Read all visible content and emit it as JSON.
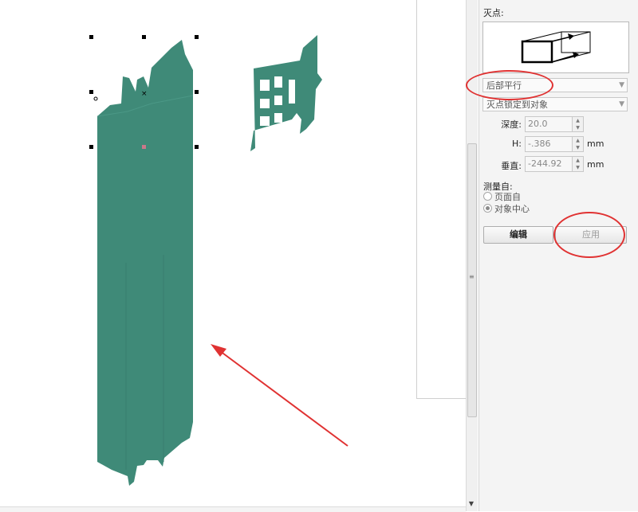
{
  "vanishing_point": {
    "label": "灭点:",
    "type_value": "后部平行",
    "lock_value": "灭点锁定到对象"
  },
  "fields": {
    "depth": {
      "label": "深度:",
      "value": "20.0",
      "unit": ""
    },
    "h": {
      "label": "H:",
      "value": "-.386",
      "unit": "mm"
    },
    "vertical": {
      "label": "垂直:",
      "value": "-244.92",
      "unit": "mm"
    }
  },
  "measure": {
    "label": "测量自:",
    "options": [
      {
        "label": "页面自",
        "selected": false
      },
      {
        "label": "对象中心",
        "selected": true
      }
    ]
  },
  "buttons": {
    "edit": "编辑",
    "apply": "应用"
  },
  "colors": {
    "shape_fill": "#3f8a78",
    "annotation_red": "#e03232"
  },
  "icons": {
    "scroll_grip": "≡",
    "scroll_down": "▼",
    "combo_arrow": "▼",
    "spin_up": "▲",
    "spin_down": "▼"
  }
}
